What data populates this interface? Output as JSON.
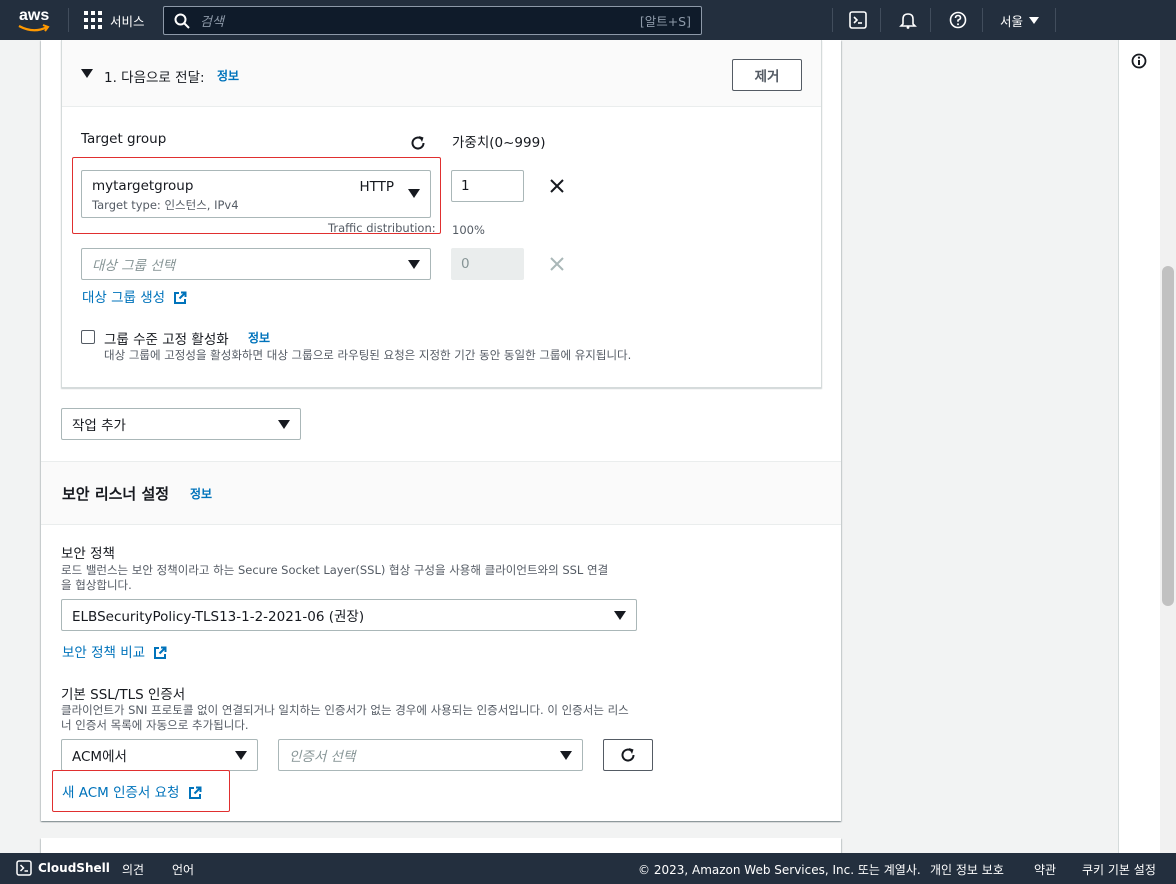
{
  "topnav": {
    "logo_text": "aws",
    "services_label": "서비스",
    "search_placeholder": "검색",
    "search_shortcut": "[알트+S]",
    "region_label": "서울"
  },
  "forward": {
    "title": "1. 다음으로 전달:",
    "info": "정보",
    "remove_label": "제거",
    "target_group_label": "Target group",
    "weight_label": "가중치(0~999)",
    "tg1": {
      "name": "mytargetgroup",
      "protocol": "HTTP",
      "subtext": "Target type: 인스턴스, IPv4",
      "weight": "1"
    },
    "traffic_label": "Traffic distribution:",
    "traffic_value": "100%",
    "tg2": {
      "placeholder": "대상 그룹 선택",
      "weight": "0"
    },
    "create_tg_link": "대상 그룹 생성",
    "stickiness_label": "그룹 수준 고정 활성화",
    "stickiness_info": "정보",
    "stickiness_desc": "대상 그룹에 고정성을 활성화하면 대상 그룹으로 라우팅된 요청은 지정한 기간 동안 동일한 그룹에 유지됩니다."
  },
  "add_action_label": "작업 추가",
  "secure": {
    "title": "보안 리스너 설정",
    "info": "정보",
    "policy_label": "보안 정책",
    "policy_desc_1": "로드 밸런스는 보안 정책이라고 하는 Secure Socket Layer(SSL) 협상 구성을 사용해 클라이언트와의 SSL 연결",
    "policy_desc_2": "을 협상합니다.",
    "policy_value": "ELBSecurityPolicy-TLS13-1-2-2021-06 (권장)",
    "compare_link": "보안 정책 비교",
    "cert_label": "기본 SSL/TLS 인증서",
    "cert_desc_1": "클라이언트가 SNI 프로토콜 없이 연결되거나 일치하는 인증서가 없는 경우에 사용되는 인증서입니다. 이 인증서는 리스",
    "cert_desc_2": "너 인증서 목록에 자동으로 추가됩니다.",
    "cert_source": "ACM에서",
    "cert_placeholder": "인증서 선택",
    "request_link": "새 ACM 인증서 요청"
  },
  "footer": {
    "cloudshell": "CloudShell",
    "feedback": "의견",
    "language": "언어",
    "copyright": "© 2023, Amazon Web Services, Inc. 또는 계열사.",
    "privacy": "개인 정보 보호",
    "terms": "약관",
    "cookies": "쿠키 기본 설정"
  },
  "colors": {
    "nav_bg": "#232f3e",
    "link": "#0073bb",
    "highlight": "#e02f2f"
  }
}
